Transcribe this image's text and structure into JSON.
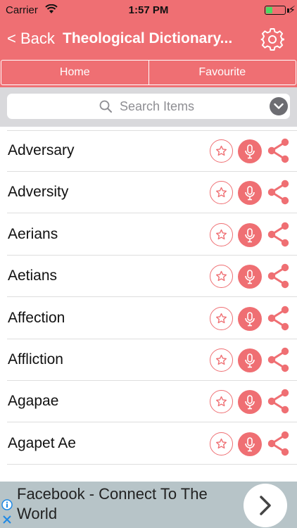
{
  "status_bar": {
    "carrier": "Carrier",
    "time": "1:57 PM",
    "battery_level": 0.35,
    "battery_color": "#4cd964"
  },
  "nav": {
    "back_label": "< Back",
    "title": "Theological Dictionary...",
    "settings_icon": "gear-icon"
  },
  "tabs": [
    {
      "label": "Home"
    },
    {
      "label": "Favourite"
    }
  ],
  "search": {
    "placeholder": "Search Items"
  },
  "items": [
    {
      "label": "Adversary"
    },
    {
      "label": "Adversity"
    },
    {
      "label": "Aerians"
    },
    {
      "label": "Aetians"
    },
    {
      "label": "Affection"
    },
    {
      "label": "Affliction"
    },
    {
      "label": "Agapae"
    },
    {
      "label": "Agapet Ae"
    }
  ],
  "row_actions": {
    "favorite_icon": "star-icon",
    "pronounce_icon": "microphone-icon",
    "share_icon": "share-icon"
  },
  "ad": {
    "text": "Facebook - Connect To The World"
  },
  "colors": {
    "accent": "#ef6f73",
    "search_bar_bg": "#d9d9dc",
    "ad_bg": "#b7c4c8"
  }
}
